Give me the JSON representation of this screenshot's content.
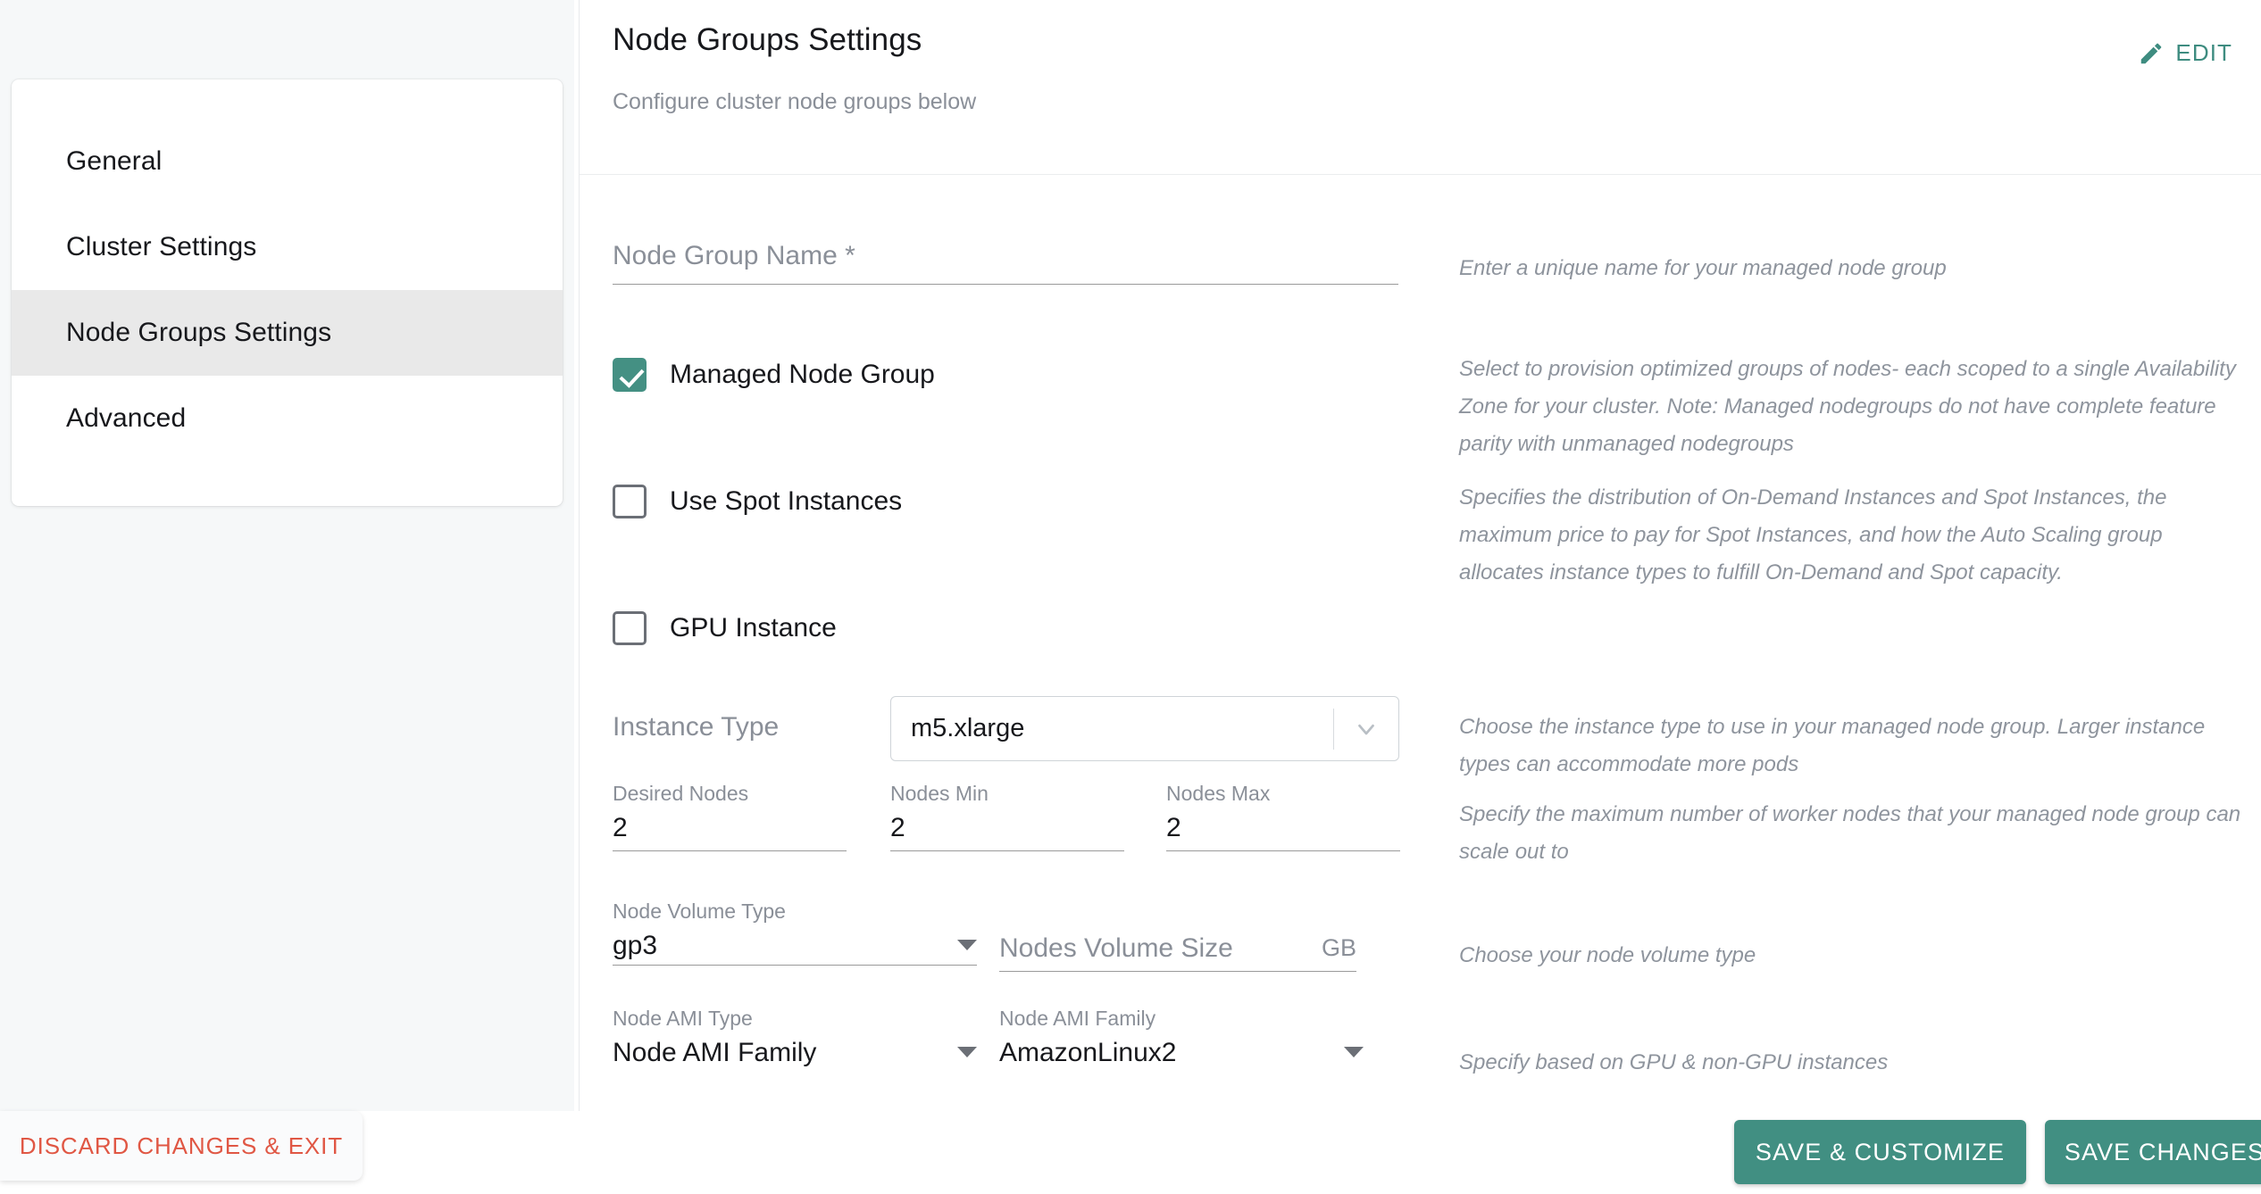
{
  "sidebar": {
    "items": [
      {
        "label": "General",
        "active": false
      },
      {
        "label": "Cluster Settings",
        "active": false
      },
      {
        "label": "Node Groups Settings",
        "active": true
      },
      {
        "label": "Advanced",
        "active": false
      }
    ]
  },
  "panel": {
    "title": "Node Groups Settings",
    "subtitle": "Configure cluster node groups below",
    "edit_label": "EDIT",
    "edit_icon": "pencil-icon"
  },
  "form": {
    "node_group_name": {
      "label": "Node Group Name *",
      "value": "",
      "placeholder": "Node Group Name *",
      "help": "Enter a unique name for your managed node group"
    },
    "managed_node_group": {
      "label": "Managed Node Group",
      "checked": true,
      "help": "Select to provision optimized groups of nodes- each scoped to a single Availability Zone for your cluster. Note: Managed nodegroups do not have complete feature parity with unmanaged nodegroups"
    },
    "use_spot_instances": {
      "label": "Use Spot Instances",
      "checked": false,
      "help": "Specifies the distribution of On-Demand Instances and Spot Instances, the maximum price to pay for Spot Instances, and how the Auto Scaling group allocates instance types to fulfill On-Demand and Spot capacity."
    },
    "gpu_instance": {
      "label": "GPU Instance",
      "checked": false
    },
    "instance_type": {
      "label": "Instance Type",
      "value": "m5.xlarge",
      "help": "Choose the instance type to use in your managed node group. Larger instance types can accommodate more pods"
    },
    "desired_nodes": {
      "label": "Desired Nodes",
      "value": "2"
    },
    "nodes_min": {
      "label": "Nodes Min",
      "value": "2"
    },
    "nodes_max": {
      "label": "Nodes Max",
      "value": "2",
      "help": "Specify the maximum number of worker nodes that your managed node group can scale out to"
    },
    "node_volume_type": {
      "label": "Node Volume Type",
      "value": "gp3",
      "help": "Choose your node volume type"
    },
    "nodes_volume_size": {
      "label": "Nodes Volume Size",
      "value": "",
      "placeholder": "Nodes Volume Size",
      "unit": "GB"
    },
    "node_ami_type": {
      "label": "Node AMI Type",
      "value": "Node AMI Family"
    },
    "node_ami_family": {
      "label": "Node AMI Family",
      "value": "AmazonLinux2",
      "help": "Specify based on GPU & non-GPU instances"
    }
  },
  "footer": {
    "discard_label": "DISCARD CHANGES & EXIT",
    "save_customize_label": "SAVE & CUSTOMIZE",
    "save_changes_label": "SAVE CHANGES"
  },
  "colors": {
    "accent_teal": "#418f82",
    "danger_red": "#e05744",
    "help_text": "#8e949d",
    "active_nav_bg": "#e9e9e9"
  }
}
